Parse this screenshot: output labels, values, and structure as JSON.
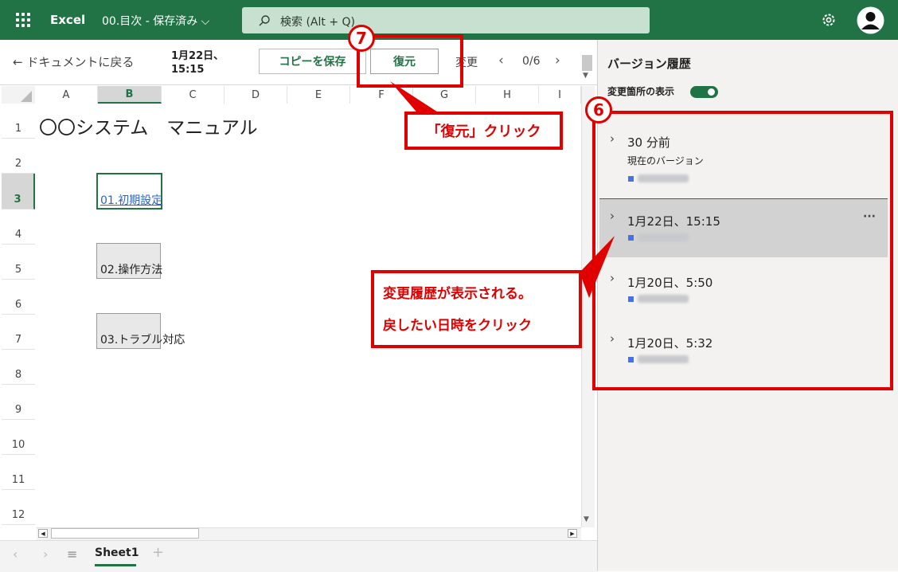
{
  "header": {
    "app_name": "Excel",
    "doc_title": "00.目次 - 保存済み",
    "search_placeholder": "検索 (Alt + Q)"
  },
  "toolbar": {
    "back_label": "ドキュメントに戻る",
    "timestamp_line1": "1月22日、",
    "timestamp_line2": "15:15",
    "save_copy_label": "コピーを保存",
    "restore_label": "復元",
    "changes_label": "変更",
    "page_counter": "0/6"
  },
  "sheet": {
    "columns": [
      "A",
      "B",
      "C",
      "D",
      "E",
      "F",
      "G",
      "H",
      "I"
    ],
    "rows": [
      "1",
      "2",
      "3",
      "4",
      "5",
      "6",
      "7",
      "8",
      "9",
      "10",
      "11",
      "12"
    ],
    "title": "〇〇システム　マニュアル",
    "link1": "01.初期設定",
    "item2": "02.操作方法",
    "item3": "03.トラブル対応",
    "tab_name": "Sheet1"
  },
  "panel": {
    "title": "バージョン履歴",
    "show_changes_label": "変更箇所の表示",
    "versions": [
      {
        "time": "30 分前",
        "subtitle": "現在のバージョン"
      },
      {
        "time": "1月22日、15:15",
        "more": "···"
      },
      {
        "time": "1月20日、5:50"
      },
      {
        "time": "1月20日、5:32"
      }
    ]
  },
  "annotations": {
    "step6": "6",
    "step7": "7",
    "callout_restore": "「復元」クリック",
    "callout_history_line1": "変更履歴が表示される。",
    "callout_history_line2": "戻したい日時をクリック"
  },
  "colors": {
    "accent": "#217346",
    "annotation": "#e00000"
  }
}
